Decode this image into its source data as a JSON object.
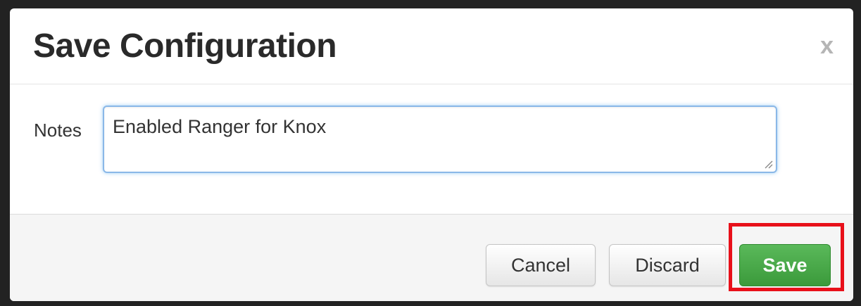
{
  "dialog": {
    "title": "Save Configuration",
    "close_label": "x"
  },
  "form": {
    "notes_label": "Notes",
    "notes_value": "Enabled Ranger for Knox"
  },
  "footer": {
    "cancel_label": "Cancel",
    "discard_label": "Discard",
    "save_label": "Save"
  },
  "colors": {
    "save_button": "#46a546",
    "highlight": "#e8101a",
    "input_focus_border": "#8ab8e8"
  }
}
